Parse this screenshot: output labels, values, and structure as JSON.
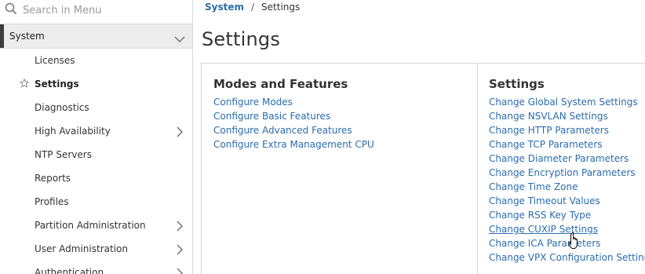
{
  "search": {
    "placeholder": "Search in Menu"
  },
  "sidebar": {
    "section": "System",
    "items": [
      {
        "label": "Licenses"
      },
      {
        "label": "Settings"
      },
      {
        "label": "Diagnostics"
      },
      {
        "label": "High Availability"
      },
      {
        "label": "NTP Servers"
      },
      {
        "label": "Reports"
      },
      {
        "label": "Profiles"
      },
      {
        "label": "Partition Administration"
      },
      {
        "label": "User Administration"
      },
      {
        "label": "Authentication"
      }
    ]
  },
  "breadcrumb": {
    "parent": "System",
    "separator": "/",
    "current": "Settings"
  },
  "page": {
    "title": "Settings"
  },
  "modes": {
    "title": "Modes and Features",
    "links": [
      "Configure Modes",
      "Configure Basic Features",
      "Configure Advanced Features",
      "Configure Extra Management CPU"
    ]
  },
  "settings": {
    "title": "Settings",
    "links": [
      "Change Global System Settings",
      "Change NSVLAN Settings",
      "Change HTTP Parameters",
      "Change TCP Parameters",
      "Change Diameter Parameters",
      "Change Encryption Parameters",
      "Change Time Zone",
      "Change Timeout Values",
      "Change RSS Key Type",
      "Change CUXIP Settings",
      "Change ICA Parameters",
      "Change VPX Configuration Settings"
    ]
  },
  "colors": {
    "link": "#2a6db0",
    "accent": "#3d3d3d"
  }
}
